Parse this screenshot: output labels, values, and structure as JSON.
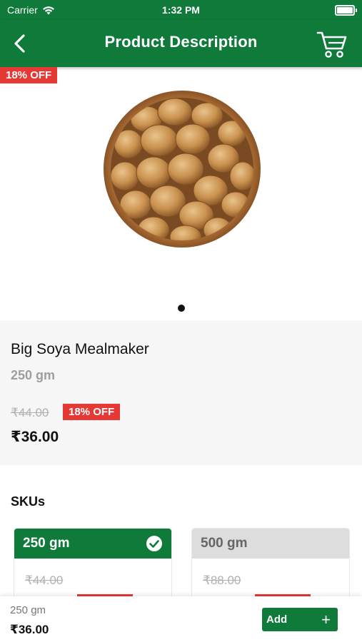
{
  "status_bar": {
    "carrier": "Carrier",
    "time": "1:32 PM"
  },
  "nav": {
    "title": "Product Description"
  },
  "product": {
    "discount_badge": "18% OFF",
    "name": "Big Soya Mealmaker",
    "weight": "250 gm",
    "mrp": "₹44.00",
    "discount": "18% OFF",
    "price": "₹36.00"
  },
  "skus": {
    "title": "SKUs",
    "options": [
      {
        "label": "250 gm",
        "mrp": "₹44.00",
        "selected": true
      },
      {
        "label": "500 gm",
        "mrp": "₹88.00",
        "selected": false
      }
    ]
  },
  "bottom_bar": {
    "weight": "250 gm",
    "price": "₹36.00",
    "add_label": "Add"
  },
  "colors": {
    "brand_green": "#0f7a3a",
    "discount_red": "#e53935"
  },
  "icons": [
    "wifi-icon",
    "battery-icon",
    "back-arrow-icon",
    "cart-icon",
    "check-circle-icon",
    "plus-icon"
  ]
}
